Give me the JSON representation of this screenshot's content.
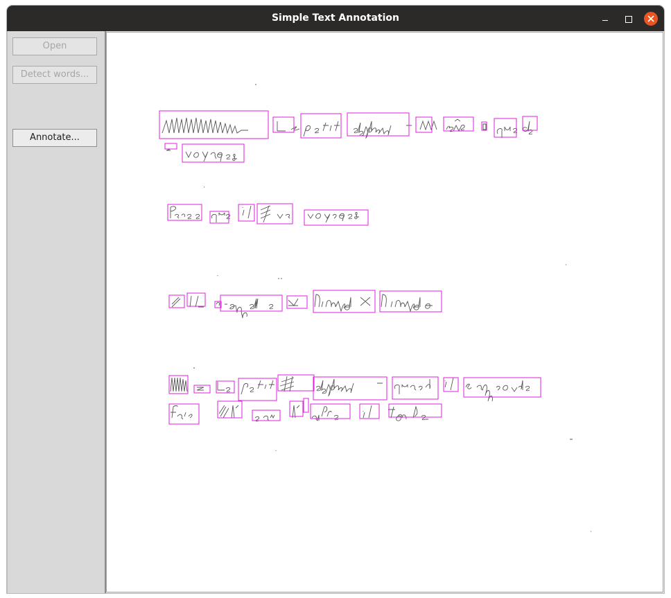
{
  "window": {
    "title": "Simple Text Annotation"
  },
  "toolbar": {
    "open_label": "Open",
    "detect_label": "Detect words...",
    "annotate_label": "Annotate..."
  },
  "colors": {
    "titlebar": "#2c2a28",
    "close_button": "#e95420",
    "word_box": "#e01ee0"
  },
  "document": {
    "lines": [
      [
        "Le",
        "petit",
        "éléphant",
        "rêve",
        "que",
        "de",
        "voyages."
      ],
      [
        "Parce",
        "que",
        "il",
        "va",
        "voyages."
      ],
      [
        "Il",
        "s'appelle",
        "Limpolo",
        "Limpolo."
      ],
      [
        "Le",
        "petit",
        "éléphant",
        "quand",
        "il",
        "s'approche",
        "faire",
        "l'eau",
        "l'arbre",
        "il",
        "tombe."
      ]
    ]
  }
}
